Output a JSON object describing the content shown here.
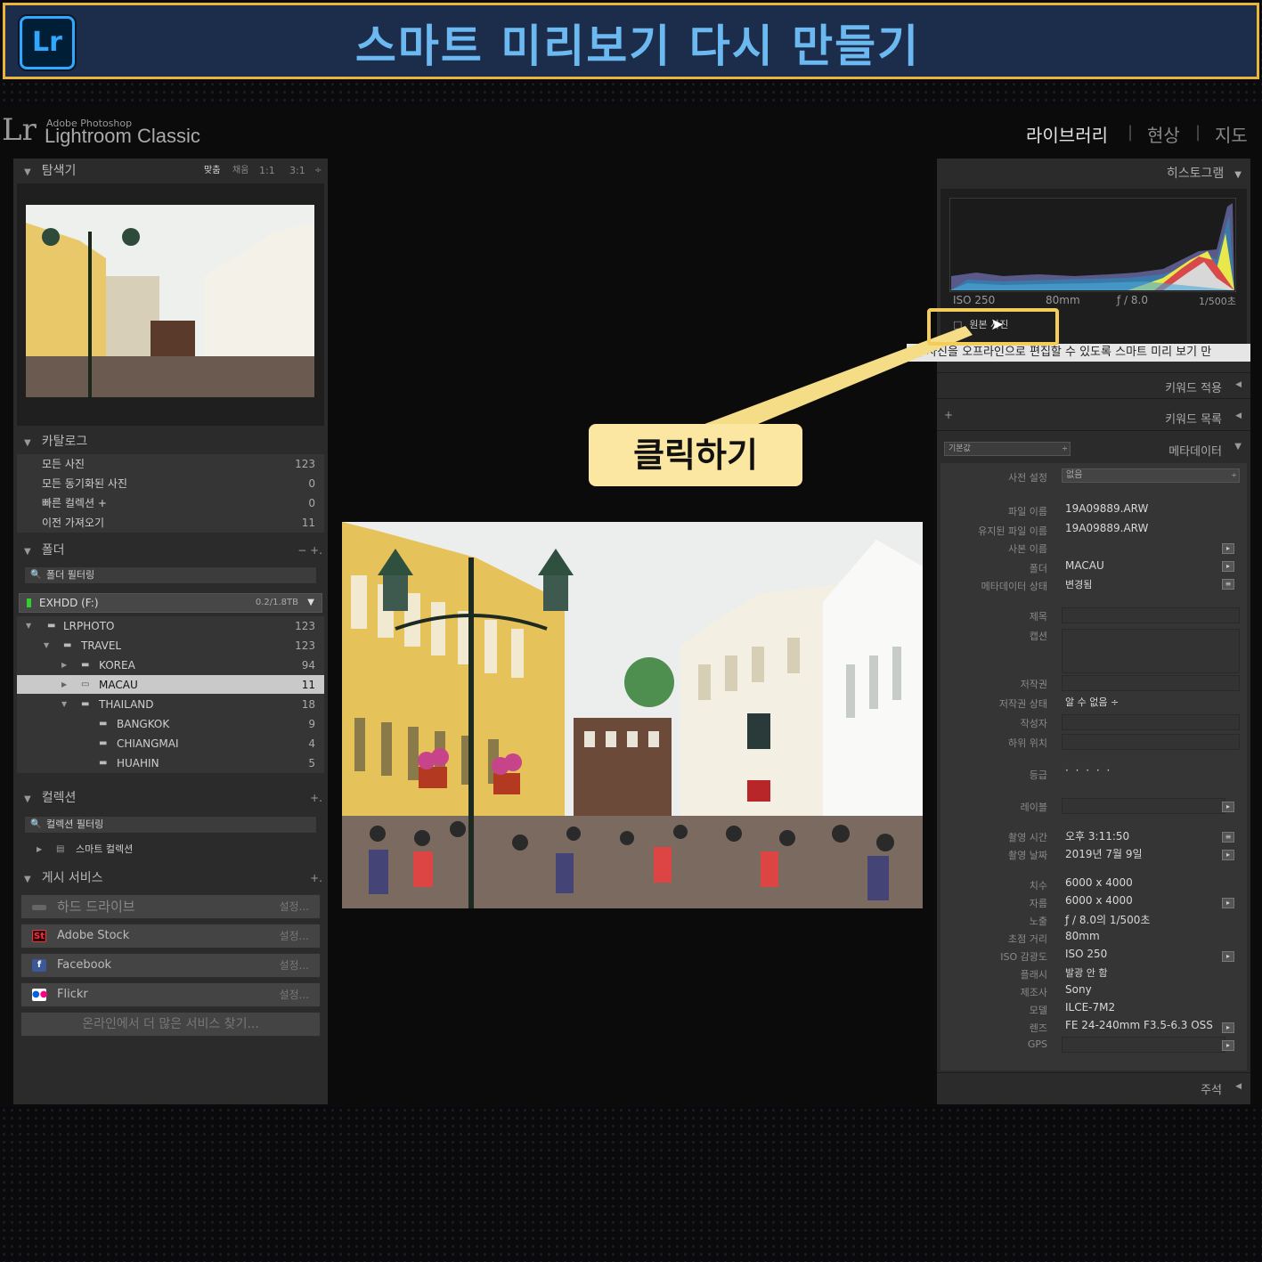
{
  "banner": {
    "logo": "Lr",
    "title": "스마트 미리보기 다시 만들기"
  },
  "appbar": {
    "lr": "Lr",
    "subtitle": "Adobe Photoshop",
    "name": "Lightroom Classic",
    "modules": [
      "라이브러리",
      "현상",
      "지도"
    ]
  },
  "navigator": {
    "title": "탐색기",
    "options": [
      "맞춤",
      "채움",
      "1:1",
      "3:1"
    ]
  },
  "catalog": {
    "title": "카탈로그",
    "items": [
      {
        "label": "모든 사진",
        "count": "123"
      },
      {
        "label": "모든 동기화된 사진",
        "count": "0"
      },
      {
        "label": "빠른 컬렉션 +",
        "count": "0"
      },
      {
        "label": "이전 가져오기",
        "count": "11"
      }
    ]
  },
  "folders": {
    "title": "폴더",
    "actions": "− +.",
    "filter_placeholder": "폴더 필터링",
    "volume": {
      "name": "EXHDD (F:)",
      "size": "0.2/1.8TB"
    },
    "tree": [
      {
        "label": "LRPHOTO",
        "count": "123"
      },
      {
        "label": "TRAVEL",
        "count": "123"
      },
      {
        "label": "KOREA",
        "count": "94"
      },
      {
        "label": "MACAU",
        "count": "11"
      },
      {
        "label": "THAILAND",
        "count": "18"
      },
      {
        "label": "BANGKOK",
        "count": "9"
      },
      {
        "label": "CHIANGMAI",
        "count": "4"
      },
      {
        "label": "HUAHIN",
        "count": "5"
      }
    ]
  },
  "collections": {
    "title": "컬렉션",
    "filter_placeholder": "컬렉션 필터링",
    "item": "스마트 컬렉션"
  },
  "publish": {
    "title": "게시 서비스",
    "services": [
      {
        "label": "하드 드라이브",
        "setting": "설정..."
      },
      {
        "label": "Adobe Stock",
        "setting": "설정..."
      },
      {
        "label": "Facebook",
        "setting": "설정..."
      },
      {
        "label": "Flickr",
        "setting": "설정..."
      }
    ],
    "more": "온라인에서 더 많은 서비스 찾기..."
  },
  "histogram": {
    "title": "히스토그램",
    "iso": "ISO 250",
    "focal": "80mm",
    "aperture": "ƒ / 8.0",
    "shutter": "1/500초",
    "original_label": "원본 사진",
    "tooltip": "이 사진을 오프라인으로 편집할 수 있도록 스마트 미리 보기 만"
  },
  "right_sections": {
    "keyword_apply": "키워드 적용",
    "keyword_list": "키워드 목록",
    "metadata": "메타데이터",
    "metadata_preset": "기본값",
    "comments": "주석"
  },
  "metadata": {
    "preset_label": "사전 설정",
    "preset_value": "없음",
    "file_name_label": "파일 이름",
    "file_name": "19A09889.ARW",
    "preserved_label": "유지된 파일 이름",
    "preserved": "19A09889.ARW",
    "copy_label": "사본 이름",
    "folder_label": "폴더",
    "folder": "MACAU",
    "status_label": "메타데이터 상태",
    "status": "변경됨",
    "title_label": "제목",
    "caption_label": "캡션",
    "copyright_label": "저작권",
    "copyright_status_label": "저작권 상태",
    "copyright_status": "알 수 없음 ÷",
    "creator_label": "작성자",
    "sublocation_label": "하위 위치",
    "rating_label": "등급",
    "rating": "·  ·  ·  ·  ·",
    "color_label_label": "레이블",
    "capture_time_label": "촬영 시간",
    "capture_time": "오후 3:11:50",
    "capture_date_label": "촬영 날짜",
    "capture_date": "2019년 7월 9일",
    "dimensions_label": "치수",
    "dimensions": "6000 x 4000",
    "cropped_label": "자름",
    "cropped": "6000 x 4000",
    "exposure_label": "노출",
    "exposure": "ƒ / 8.0의 1/500초",
    "focal_label": "초점 거리",
    "focal": "80mm",
    "iso_label": "ISO 감광도",
    "iso": "ISO 250",
    "flash_label": "플래시",
    "flash": "발광 안 함",
    "make_label": "제조사",
    "make": "Sony",
    "model_label": "모델",
    "model": "ILCE-7M2",
    "lens_label": "렌즈",
    "lens": "FE 24-240mm F3.5-6.3 OSS",
    "gps_label": "GPS"
  },
  "callout": {
    "text": "클릭하기"
  },
  "colors": {
    "accent": "#e8b53a",
    "callout_bg": "#fbe6a2",
    "panel": "#2b2b2b",
    "banner": "#1b2d4a"
  }
}
